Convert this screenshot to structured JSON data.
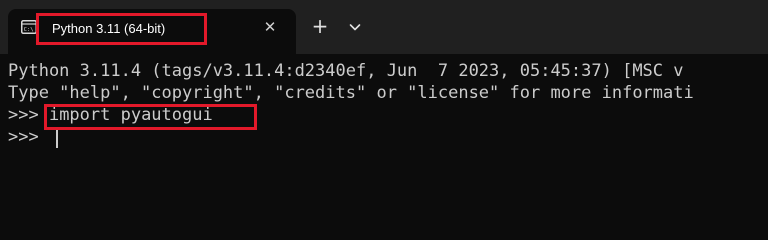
{
  "tab": {
    "title": "Python 3.11 (64-bit)",
    "icon": "terminal-icon",
    "close_icon": "close-icon"
  },
  "toolbar": {
    "new_tab_icon": "plus-icon",
    "new_tab_label": "+",
    "dropdown_icon": "chevron-down-icon",
    "close_label": "✕"
  },
  "console": {
    "line1": "Python 3.11.4 (tags/v3.11.4:d2340ef, Jun  7 2023, 05:45:37) [MSC v",
    "line2": "Type \"help\", \"copyright\", \"credits\" or \"license\" for more informati",
    "line3_prompt": ">>>",
    "line3_command": " import pyautogui",
    "line4_prompt": ">>>"
  },
  "colors": {
    "terminal_bg": "#0c0c0c",
    "titlebar_bg": "#202020",
    "text": "#cccccc",
    "highlight": "#e3192a"
  }
}
